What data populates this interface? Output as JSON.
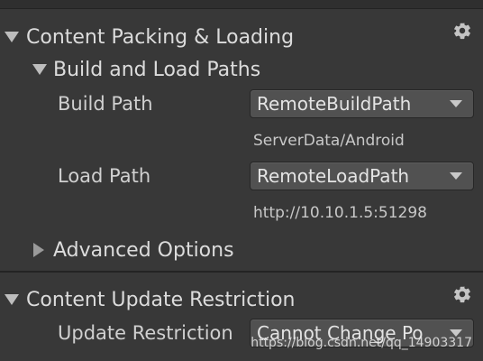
{
  "content_packing": {
    "title": "Content Packing & Loading",
    "build_load_paths": {
      "title": "Build and Load Paths",
      "build_path_label": "Build Path",
      "build_path_value": "RemoteBuildPath",
      "build_path_resolved": "ServerData/Android",
      "load_path_label": "Load Path",
      "load_path_value": "RemoteLoadPath",
      "load_path_resolved": "http://10.10.1.5:51298"
    },
    "advanced_options": "Advanced Options"
  },
  "content_update": {
    "title": "Content Update Restriction",
    "update_restriction_label": "Update Restriction",
    "update_restriction_value": "Cannot Change Po"
  },
  "watermark": "https://blog.csdn.net/qq_14903317",
  "icons": {
    "gear": "gear-icon",
    "expand": "triangle-down-icon",
    "collapse": "triangle-right-icon",
    "dropdown": "dropdown-arrow-icon"
  },
  "colors": {
    "background": "#383838",
    "text": "#d2d2d2",
    "dropdown_bg": "#515151",
    "divider": "#232323"
  }
}
